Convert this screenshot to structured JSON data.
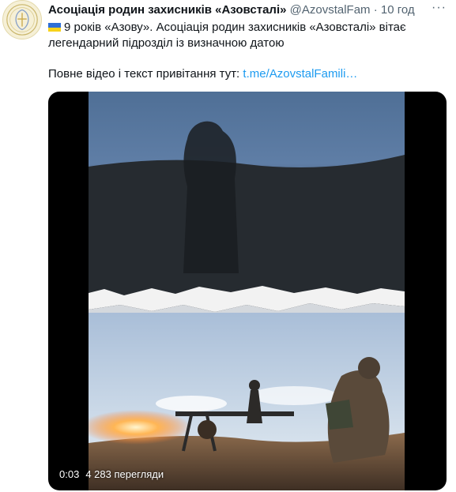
{
  "tweet": {
    "author_name": "Асоціація родин захисників «Азовсталі»",
    "handle": "@AzovstalFam",
    "separator": "·",
    "time": "10 год",
    "more_icon": "more-horizontal-icon",
    "flag_icon": "ukraine-flag-icon",
    "text_line1": "9 років «Азову». Асоціація родин захисників «Азовсталі» вітає",
    "text_line2": "легендарний підрозділ із визначною датою",
    "text_line3_prefix": "Повне відео і текст привітання тут: ",
    "link_text": "t.me/AzovstalFamili…"
  },
  "media": {
    "elapsed": "0:03",
    "views": "4 283 перегляди"
  },
  "colors": {
    "link": "#1d9bf0",
    "secondary_text": "#536471",
    "primary_text": "#0f1419"
  }
}
